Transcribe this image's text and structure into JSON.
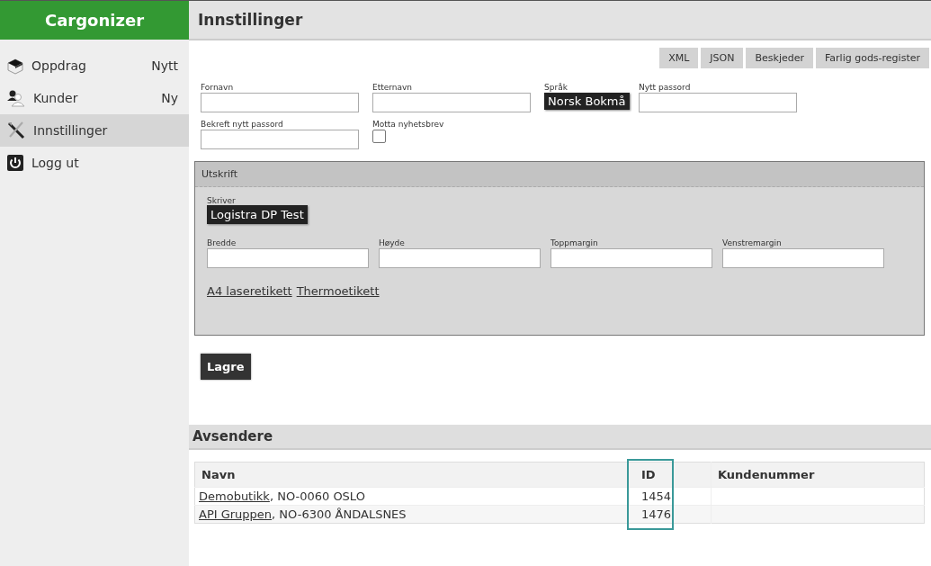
{
  "sidebar": {
    "logo": "Cargonizer",
    "items": [
      {
        "kind": "box",
        "label": "Oppdrag",
        "badge": "Nytt",
        "selected": false
      },
      {
        "kind": "users",
        "label": "Kunder",
        "badge": "Ny",
        "selected": false
      },
      {
        "kind": "tools",
        "label": "Innstillinger",
        "selected": true
      },
      {
        "kind": "power",
        "label": "Logg ut",
        "selected": false
      }
    ]
  },
  "page": {
    "title": "Innstillinger",
    "actions": [
      "XML",
      "JSON",
      "Beskjeder",
      "Farlig gods-register"
    ]
  },
  "profile_fields": [
    {
      "kind": "text",
      "label": "Fornavn"
    },
    {
      "kind": "text",
      "label": "Etternavn"
    },
    {
      "kind": "select",
      "label": "Språk",
      "value": "Norsk Bokmå"
    },
    {
      "kind": "text",
      "label": "Nytt passord"
    },
    {
      "kind": "text",
      "label": "Bekreft nytt passord"
    },
    {
      "kind": "checkbox",
      "label": "Motta nyhetsbrev",
      "checked": false
    }
  ],
  "print_panel": {
    "title": "Utskrift",
    "printer_label": "Skriver",
    "printer": "Logistra DP Test",
    "fields": [
      "Bredde",
      "Høyde",
      "Toppmargin",
      "Venstremargin"
    ],
    "links": [
      "A4 laseretikett",
      "Thermoetikett"
    ]
  },
  "save_button": "Lagre",
  "senders": {
    "title": "Avsendere",
    "columns": [
      {
        "label": "Navn",
        "highlighted": false
      },
      {
        "label": "ID",
        "highlighted": true
      },
      {
        "label": "Kundenummer",
        "highlighted": false
      }
    ],
    "rows": [
      {
        "name": "Demobutikk",
        "address": ", NO-0060 OSLO",
        "id": "1454"
      },
      {
        "name": "API Gruppen",
        "address": ", NO-6300 ÅNDALSNES",
        "id": "1476"
      }
    ]
  }
}
